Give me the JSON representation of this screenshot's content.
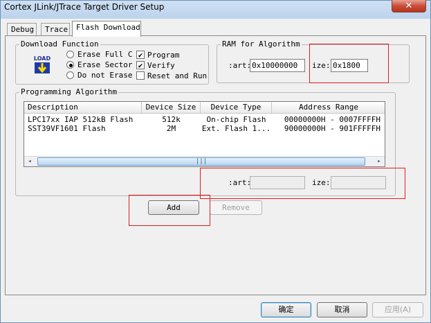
{
  "window": {
    "title": "Cortex JLink/JTrace Target Driver Setup",
    "close_glyph": "✕"
  },
  "tabs": [
    {
      "label": "Debug",
      "active": false
    },
    {
      "label": "Trace",
      "active": false
    },
    {
      "label": "Flash Download",
      "active": true
    }
  ],
  "download_function": {
    "legend": "Download Function",
    "load_icon_text": "LOAD",
    "radios": [
      {
        "label": "Erase Full C",
        "checked": false
      },
      {
        "label": "Erase Sector",
        "checked": true
      },
      {
        "label": "Do not Erase",
        "checked": false
      }
    ],
    "checkboxes": [
      {
        "label": "Program",
        "checked": true
      },
      {
        "label": "Verify",
        "checked": true
      },
      {
        "label": "Reset and Run",
        "checked": false
      }
    ]
  },
  "ram": {
    "legend": "RAM for Algorithm",
    "start_label": ":art:",
    "start_value": "0x10000000",
    "size_label": "ize:",
    "size_value": "0x1800"
  },
  "programming_algorithm": {
    "legend": "Programming Algorithm",
    "columns": [
      "Description",
      "Device Size",
      "Device Type",
      "Address Range"
    ],
    "rows": [
      [
        "LPC17xx IAP 512kB Flash",
        "512k",
        "On-chip Flash",
        "00000000H - 0007FFFFH"
      ],
      [
        "SST39VF1601 Flash",
        "2M",
        "Ext. Flash 1...",
        "90000000H - 901FFFFFH"
      ]
    ],
    "scroll_thumb_glyph": "|||",
    "scroll_left_glyph": "◂",
    "scroll_right_glyph": "▸",
    "start_label": ":art:",
    "start_value": "",
    "size_label": "ize:",
    "size_value": ""
  },
  "buttons": {
    "add": "Add",
    "remove": "Remove",
    "ok": "确定",
    "cancel": "取消",
    "apply": "应用(A)"
  },
  "check_glyph": "✔"
}
